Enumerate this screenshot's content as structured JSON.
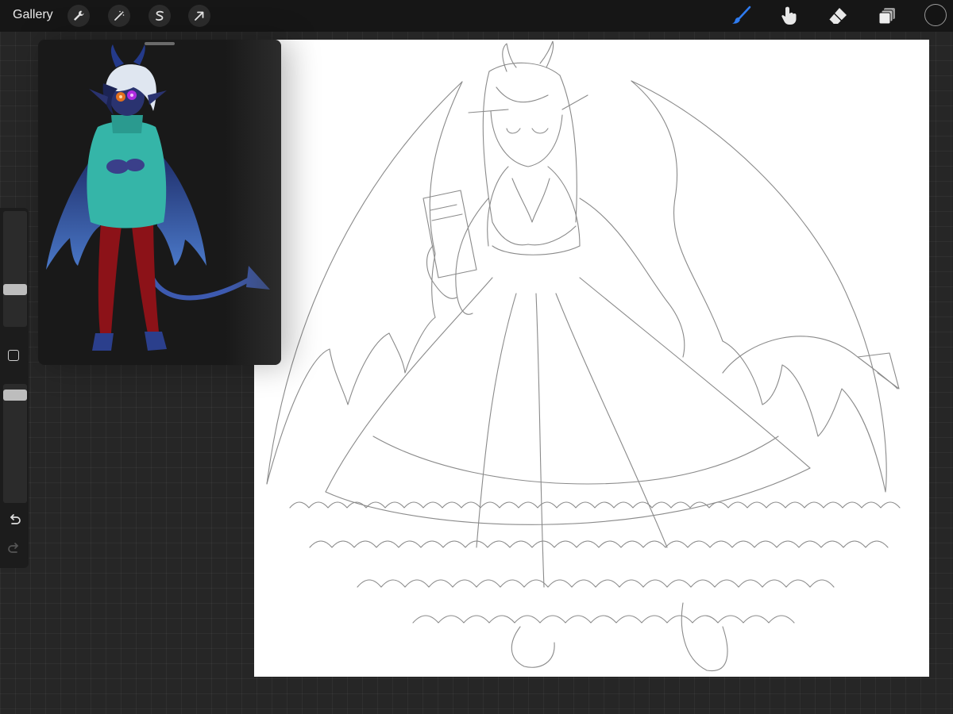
{
  "topbar": {
    "gallery_label": "Gallery",
    "left_tools": [
      "wrench-icon",
      "magic-wand-icon",
      "selection-s-icon",
      "transform-arrow-icon"
    ],
    "right_tools": [
      "brush-icon",
      "smudge-icon",
      "eraser-icon",
      "layers-icon"
    ],
    "active_tool": "brush-icon",
    "current_color": "#141414"
  },
  "sidebar": {
    "brush_size_level": 0.3,
    "opacity_level": 0.95,
    "icons": [
      "modify-square-icon",
      "undo-icon",
      "redo-icon"
    ]
  },
  "colors": {
    "accent": "#2e7bf0",
    "canvas": "#ffffff",
    "background": "#262626"
  }
}
